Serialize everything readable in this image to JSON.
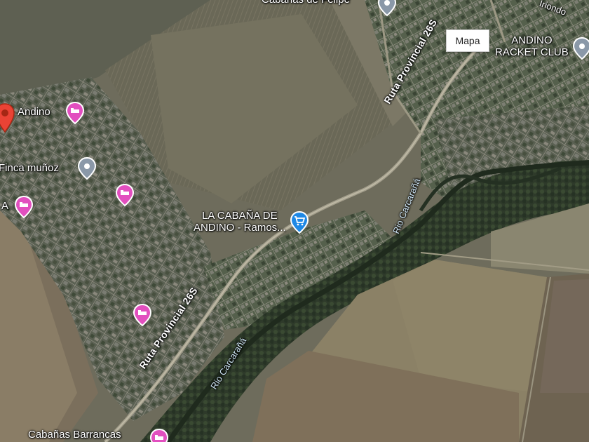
{
  "map": {
    "type_button": "Mapa",
    "places": {
      "top_partial": "Cabañas de Felipe",
      "andino": "Andino",
      "finca": "Finca muñoz",
      "partial_a": "A",
      "cabana_line1": "LA CABAÑA DE",
      "cabana_line2": "ANDINO - Ramos...",
      "racket_line1": "ANDINO",
      "racket_line2": "RACKET CLUB",
      "barrancas": "Cabañas Barrancas",
      "iriondo": "Iriondo"
    },
    "roads": {
      "ruta_upper": "Ruta Provincial 26S",
      "ruta_lower": "Ruta Provincial 26S"
    },
    "rivers": {
      "upper": "Rio Carcarañá",
      "lower": "Rio Carcarañá"
    },
    "icons": [
      "map-pin-red-icon",
      "lodging-icon",
      "generic-place-icon",
      "shopping-cart-icon"
    ],
    "colors": {
      "lodging": "#e24fbf",
      "generic": "#8a98a8",
      "shopping": "#1e88e5",
      "red_pin": "#ea4335"
    }
  }
}
